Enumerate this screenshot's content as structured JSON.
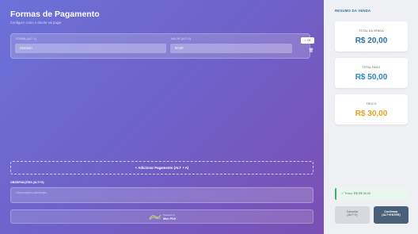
{
  "main": {
    "title": "Formas de Pagamento",
    "subtitle": "Configure como o cliente vai pagar",
    "payment": {
      "method_label": "FORMA (ALT+1)",
      "method_value": "Dinheiro",
      "amount_label": "VALOR (ALT+2)",
      "amount_value": "50,00",
      "ok_label": "✓ OK",
      "trash_icon": "trash-icon"
    },
    "add_button": "+ Adicionar Pagamento (ALT + A)",
    "observations_label": "OBSERVAÇÕES (ALT+O)",
    "observations_placeholder": "Observações adicionais...",
    "footer": {
      "powered": "Powered by",
      "brand": "Meu PDV"
    }
  },
  "sidebar": {
    "title": "RESUMO DA VENDA",
    "cards": [
      {
        "label": "TOTAL DA VENDA",
        "value": "R$ 20,00",
        "color": "#2c6ea8"
      },
      {
        "label": "TOTAL PAGO",
        "value": "R$ 50,00",
        "color": "#2e86c1"
      },
      {
        "label": "TROCO",
        "value": "R$ 30,00",
        "color": "#e0a31c"
      }
    ],
    "toast": "✓ Troco: R$ R$ 30,00",
    "cancel_label": "Cancelar",
    "cancel_hint": "(ALT+X)",
    "confirm_label": "Confirmar",
    "confirm_hint": "(ALT+ENTER)"
  }
}
